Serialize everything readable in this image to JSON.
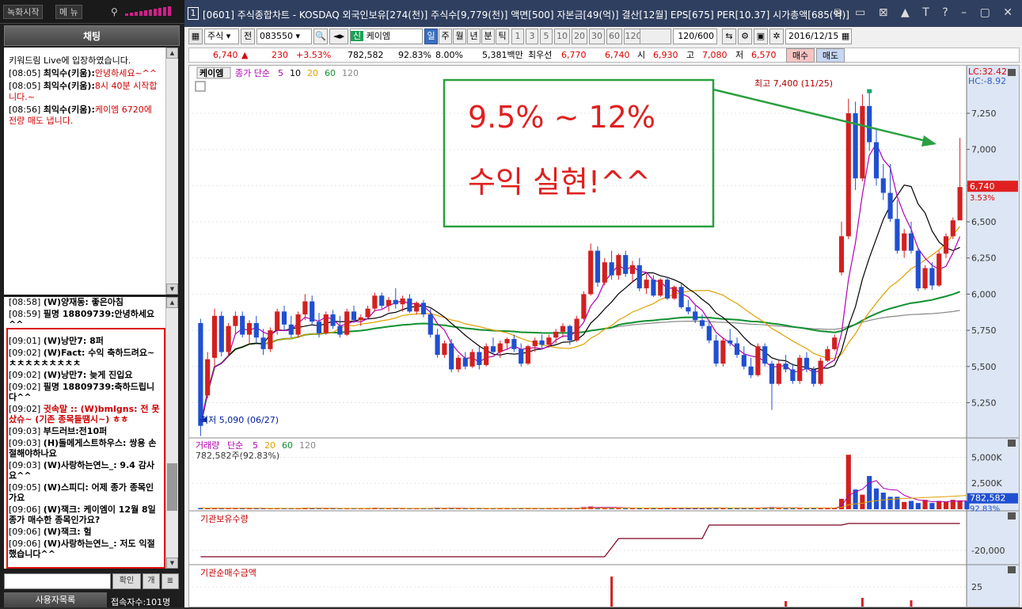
{
  "left_panel": {
    "top_buttons": [
      "녹화시작",
      "메 뉴"
    ],
    "chat_title": "채팅",
    "top_messages": [
      {
        "time": "",
        "user": "",
        "text": "키워드림 Live에 입장하였습니다."
      },
      {
        "time": "[08:05]",
        "user": "최익수(키움):",
        "text": "안녕하세요~^^"
      },
      {
        "time": "[08:05]",
        "user": "최익수(키움):",
        "text": "8시 40분 시작합니다.~"
      },
      {
        "time": "[08:56]",
        "user": "최익수(키움):",
        "text": "케이엠 6720에 전량 매도 냅니다."
      }
    ],
    "bottom_messages": [
      {
        "time": "[08:58]",
        "text": "(W)양재동: 좋은아침",
        "style": "b"
      },
      {
        "time": "[08:59]",
        "text": "필명 18809739:안녕하세요^^",
        "style": "b"
      },
      {
        "time": "[09:01]",
        "text": "(W)낭만7: 8퍼",
        "style": "b"
      },
      {
        "time": "[09:02]",
        "text": "(W)Fact: 수익 축하드려요~ ㅊㅊㅊㅊㅊㅊㅊㅊㅊ",
        "style": "b"
      },
      {
        "time": "[09:02]",
        "text": "(W)낭만7: 늦게 진입요",
        "style": "b"
      },
      {
        "time": "[09:02]",
        "text": "필명 18809739:축하드립니다^^",
        "style": "b"
      },
      {
        "time": "[09:02]",
        "text": "귓속말 :: (W)bmlgns: 전 못샀슈~ (기존 종목들땜시~) ㅎㅎ",
        "style": "rb"
      },
      {
        "time": "[09:03]",
        "text": "부드러브:전10퍼",
        "style": "b"
      },
      {
        "time": "[09:03]",
        "text": "(H)돌메게스트하우스: 쌍용 손절해야하나요",
        "style": "b"
      },
      {
        "time": "[09:03]",
        "text": "(W)사랑하는연느_: 9.4 감사요^^",
        "style": "b"
      },
      {
        "time": "[09:05]",
        "text": "(W)스피디: 어제 종가 종목인가요",
        "style": "b"
      },
      {
        "time": "[09:06]",
        "text": "(W)잭크: 케이엠이 12월 8일 종가 매수한 종목인가요?",
        "style": "b"
      },
      {
        "time": "[09:06]",
        "text": "(W)잭크: 헐",
        "style": "b"
      },
      {
        "time": "[09:06]",
        "text": "(W)사랑하는연느_: 저도 익절 했습니다^^",
        "style": "b"
      }
    ],
    "confirm_label": "확인",
    "open_label": "개",
    "user_list_label": "사용자목록",
    "user_count": "접속자수:101명"
  },
  "window": {
    "number": "1",
    "title": "[0601] 주식종합차트 - KOSDAQ 외국인보유[274(천)] 주식수[9,779(천)] 액면[500] 자본금[49(억)] 결산[12월] EPS[675] PER[10.37] 시가총액[685(억)]",
    "controls": "⧉ ▭ ⊠ ▲ T ? – ▢ ✕"
  },
  "toolbar": {
    "market": "주식",
    "prefix": "전",
    "code": "083550",
    "new_tag": "신",
    "stock_name": "케이엠",
    "periods": [
      "일",
      "주",
      "월",
      "년",
      "분",
      "틱"
    ],
    "selected_period": "일",
    "intervals": [
      "1",
      "3",
      "5",
      "10",
      "20",
      "30",
      "60",
      "120"
    ],
    "count": "120",
    "count_max": "/600",
    "date": "2016/12/15"
  },
  "quote": {
    "price": "6,740",
    "arrow": "▲",
    "change": "230",
    "change_pct": "+3.53%",
    "volume": "782,582",
    "vol_ratio": "92.83%",
    "turnover": "8.00%",
    "amount": "5,381백만",
    "best_label": "최우선",
    "best_ask": "6,770",
    "best_bid": "6,740",
    "open_label": "시",
    "open": "6,930",
    "high_label": "고",
    "high": "7,080",
    "low_label": "저",
    "low": "6,570",
    "buy_label": "매수",
    "sell_label": "매도"
  },
  "chart_data": {
    "type": "candlestick",
    "stock": "케이엠",
    "ma_label": "종가 단순",
    "ma_periods": [
      "5",
      "10",
      "20",
      "60",
      "120"
    ],
    "ma_colors": [
      "#b000b0",
      "#000000",
      "#e0a000",
      "#109030",
      "#888888"
    ],
    "y_ticks": [
      "7,250",
      "7,000",
      "6,750",
      "6,500",
      "6,250",
      "6,000",
      "5,750",
      "5,500",
      "5,250"
    ],
    "ylim": [
      5050,
      7480
    ],
    "lc": "LC:32.42",
    "hc": "HC:-8.92",
    "high_annotation": "최고 7,400 (11/25)",
    "low_annotation": "최저 5,090 (06/27)",
    "last_price": "6,740",
    "last_pct": "3.53%",
    "annotation_line1": "9.5% ~ 12%",
    "annotation_line2": "수익 실현!^^",
    "up_color": "#d22020",
    "down_color": "#2050d0",
    "candles": [
      [
        5800,
        5830,
        5020,
        5090
      ],
      [
        5300,
        5600,
        5280,
        5550
      ],
      [
        5560,
        5900,
        5500,
        5850
      ],
      [
        5850,
        5880,
        5570,
        5600
      ],
      [
        5600,
        5800,
        5580,
        5780
      ],
      [
        5780,
        5880,
        5720,
        5850
      ],
      [
        5850,
        5880,
        5700,
        5720
      ],
      [
        5720,
        5820,
        5650,
        5800
      ],
      [
        5800,
        5850,
        5660,
        5700
      ],
      [
        5700,
        5760,
        5580,
        5620
      ],
      [
        5620,
        5770,
        5600,
        5750
      ],
      [
        5750,
        5900,
        5720,
        5880
      ],
      [
        5880,
        5920,
        5750,
        5790
      ],
      [
        5790,
        5850,
        5700,
        5720
      ],
      [
        5720,
        5880,
        5700,
        5860
      ],
      [
        5860,
        6000,
        5820,
        5950
      ],
      [
        5950,
        5990,
        5790,
        5810
      ],
      [
        5810,
        5870,
        5700,
        5730
      ],
      [
        5730,
        5880,
        5720,
        5860
      ],
      [
        5860,
        5890,
        5760,
        5780
      ],
      [
        5780,
        5850,
        5700,
        5720
      ],
      [
        5720,
        5900,
        5710,
        5880
      ],
      [
        5880,
        5920,
        5800,
        5820
      ],
      [
        5820,
        5860,
        5780,
        5840
      ],
      [
        5840,
        5920,
        5830,
        5900
      ],
      [
        5900,
        6010,
        5880,
        5990
      ],
      [
        5990,
        6010,
        5900,
        5920
      ],
      [
        5920,
        5980,
        5880,
        5960
      ],
      [
        5960,
        6040,
        5900,
        5930
      ],
      [
        5930,
        5990,
        5880,
        5970
      ],
      [
        5970,
        6000,
        5870,
        5880
      ],
      [
        5880,
        5950,
        5860,
        5940
      ],
      [
        5940,
        5960,
        5840,
        5860
      ],
      [
        5860,
        5900,
        5700,
        5720
      ],
      [
        5720,
        5760,
        5560,
        5580
      ],
      [
        5580,
        5680,
        5560,
        5660
      ],
      [
        5660,
        5690,
        5460,
        5480
      ],
      [
        5480,
        5580,
        5460,
        5560
      ],
      [
        5560,
        5600,
        5480,
        5500
      ],
      [
        5500,
        5620,
        5490,
        5600
      ],
      [
        5600,
        5640,
        5480,
        5510
      ],
      [
        5510,
        5660,
        5500,
        5640
      ],
      [
        5640,
        5700,
        5580,
        5600
      ],
      [
        5600,
        5680,
        5560,
        5660
      ],
      [
        5660,
        5700,
        5620,
        5690
      ],
      [
        5690,
        5720,
        5600,
        5620
      ],
      [
        5620,
        5660,
        5500,
        5520
      ],
      [
        5520,
        5650,
        5510,
        5640
      ],
      [
        5640,
        5700,
        5600,
        5680
      ],
      [
        5680,
        5720,
        5620,
        5650
      ],
      [
        5650,
        5720,
        5630,
        5700
      ],
      [
        5700,
        5760,
        5660,
        5740
      ],
      [
        5740,
        5800,
        5700,
        5780
      ],
      [
        5780,
        5790,
        5650,
        5680
      ],
      [
        5680,
        5850,
        5670,
        5830
      ],
      [
        5830,
        6020,
        5820,
        6000
      ],
      [
        6000,
        6350,
        5990,
        6300
      ],
      [
        6300,
        6330,
        6050,
        6080
      ],
      [
        6080,
        6250,
        6060,
        6220
      ],
      [
        6220,
        6300,
        6100,
        6130
      ],
      [
        6130,
        6280,
        6100,
        6270
      ],
      [
        6270,
        6300,
        6120,
        6140
      ],
      [
        6140,
        6230,
        6080,
        6200
      ],
      [
        6200,
        6250,
        6020,
        6040
      ],
      [
        6040,
        6140,
        6000,
        6100
      ],
      [
        6100,
        6130,
        5980,
        5990
      ],
      [
        5990,
        6110,
        5980,
        6100
      ],
      [
        6100,
        6120,
        5960,
        5970
      ],
      [
        5970,
        6060,
        5960,
        6050
      ],
      [
        6050,
        6070,
        5900,
        5910
      ],
      [
        5910,
        5960,
        5860,
        5880
      ],
      [
        5880,
        5920,
        5800,
        5820
      ],
      [
        5820,
        5860,
        5760,
        5780
      ],
      [
        5780,
        5820,
        5660,
        5680
      ],
      [
        5680,
        5720,
        5500,
        5520
      ],
      [
        5520,
        5700,
        5500,
        5680
      ],
      [
        5680,
        5760,
        5640,
        5660
      ],
      [
        5660,
        5700,
        5560,
        5580
      ],
      [
        5580,
        5640,
        5480,
        5500
      ],
      [
        5500,
        5560,
        5420,
        5440
      ],
      [
        5440,
        5660,
        5430,
        5640
      ],
      [
        5640,
        5660,
        5500,
        5520
      ],
      [
        5520,
        5540,
        5200,
        5380
      ],
      [
        5380,
        5540,
        5370,
        5520
      ],
      [
        5520,
        5580,
        5460,
        5480
      ],
      [
        5480,
        5520,
        5380,
        5400
      ],
      [
        5400,
        5580,
        5380,
        5560
      ],
      [
        5560,
        5600,
        5460,
        5480
      ],
      [
        5480,
        5500,
        5360,
        5380
      ],
      [
        5380,
        5560,
        5370,
        5540
      ],
      [
        5540,
        5640,
        5530,
        5620
      ],
      [
        5620,
        5720,
        5610,
        5700
      ],
      [
        6150,
        6500,
        6130,
        6400
      ],
      [
        6400,
        7350,
        6380,
        7250
      ],
      [
        7250,
        7330,
        6720,
        6800
      ],
      [
        6800,
        7380,
        6780,
        7300
      ],
      [
        7300,
        7400,
        6990,
        7050
      ],
      [
        7050,
        7150,
        6750,
        6800
      ],
      [
        6800,
        6900,
        6650,
        6700
      ],
      [
        6700,
        6900,
        6500,
        6520
      ],
      [
        6520,
        6650,
        6280,
        6300
      ],
      [
        6300,
        6450,
        6250,
        6420
      ],
      [
        6420,
        6500,
        6280,
        6300
      ],
      [
        6300,
        6320,
        6020,
        6040
      ],
      [
        6040,
        6200,
        6030,
        6180
      ],
      [
        6180,
        6220,
        6030,
        6060
      ],
      [
        6060,
        6300,
        6050,
        6280
      ],
      [
        6280,
        6420,
        6250,
        6400
      ],
      [
        6400,
        6530,
        6380,
        6510
      ],
      [
        6510,
        7080,
        6570,
        6740
      ]
    ]
  },
  "volume_panel": {
    "title": "거래량",
    "ma_label": "단순",
    "ma_periods": [
      "5",
      "20",
      "60",
      "120"
    ],
    "value_label": "782,582주(92.83%)",
    "y_ticks": [
      "5,000K",
      "2,500K"
    ],
    "last_value": "782,582",
    "last_pct": "92.83%",
    "bars_k": [
      120,
      90,
      100,
      80,
      70,
      110,
      85,
      95,
      70,
      65,
      80,
      90,
      70,
      60,
      95,
      130,
      85,
      70,
      80,
      75,
      65,
      90,
      80,
      60,
      85,
      140,
      70,
      60,
      90,
      75,
      65,
      80,
      60,
      110,
      150,
      80,
      120,
      70,
      65,
      90,
      80,
      95,
      70,
      80,
      90,
      60,
      110,
      75,
      80,
      70,
      85,
      95,
      80,
      130,
      110,
      200,
      260,
      170,
      140,
      120,
      130,
      110,
      100,
      120,
      95,
      100,
      90,
      110,
      85,
      100,
      90,
      110,
      100,
      130,
      160,
      100,
      90,
      110,
      130,
      150,
      140,
      100,
      200,
      120,
      110,
      130,
      100,
      110,
      130,
      100,
      90,
      120,
      1000,
      5250,
      1900,
      1400,
      3200,
      2000,
      1600,
      1200,
      1200,
      700,
      800,
      600,
      900,
      600,
      800,
      700,
      900,
      850,
      780
    ]
  },
  "inst_hold_panel": {
    "title": "기관보유수량",
    "y_tick": "-20,000"
  },
  "inst_net_panel": {
    "title": "기관순매수금액",
    "y_tick": "25"
  }
}
